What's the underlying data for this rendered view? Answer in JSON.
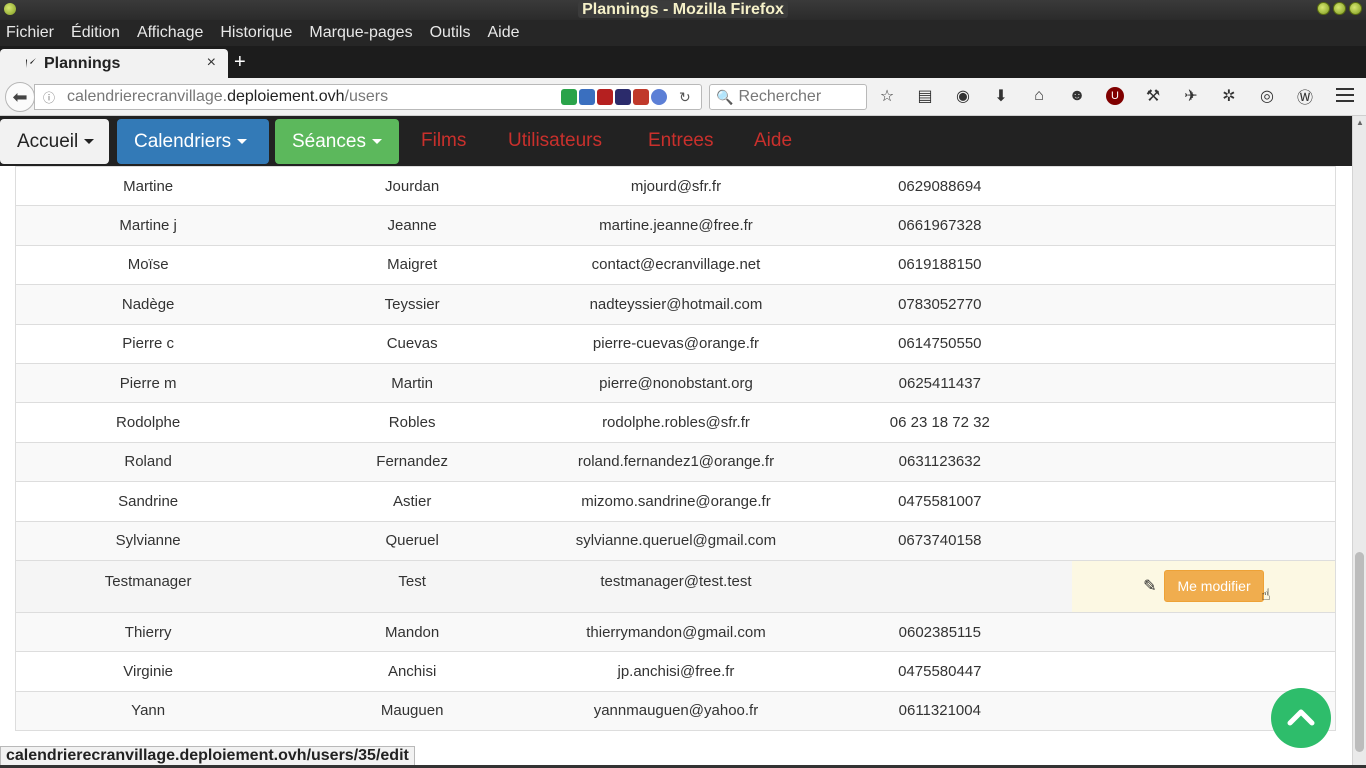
{
  "window": {
    "title": "Plannings - Mozilla Firefox"
  },
  "menubar": [
    "Fichier",
    "Édition",
    "Affichage",
    "Historique",
    "Marque-pages",
    "Outils",
    "Aide"
  ],
  "tab": {
    "title": "Plannings",
    "close": "×",
    "new": "+"
  },
  "nav": {
    "url_prefix": "calendrierecranvillage.",
    "url_domain": "deploiement.ovh",
    "url_path": "/users",
    "search_placeholder": "Rechercher"
  },
  "appnav": {
    "accueil": "Accueil",
    "calendriers": "Calendriers",
    "seances": "Séances",
    "films": "Films",
    "utilisateurs": "Utilisateurs",
    "entrees": "Entrees",
    "aide": "Aide"
  },
  "users": [
    {
      "prenom": "Martine",
      "nom": "Jourdan",
      "email": "mjourd@sfr.fr",
      "tel": "0629088694"
    },
    {
      "prenom": "Martine j",
      "nom": "Jeanne",
      "email": "martine.jeanne@free.fr",
      "tel": "0661967328"
    },
    {
      "prenom": "Moïse",
      "nom": "Maigret",
      "email": "contact@ecranvillage.net",
      "tel": "0619188150"
    },
    {
      "prenom": "Nadège",
      "nom": "Teyssier",
      "email": "nadteyssier@hotmail.com",
      "tel": "0783052770"
    },
    {
      "prenom": "Pierre c",
      "nom": "Cuevas",
      "email": "pierre-cuevas@orange.fr",
      "tel": "0614750550"
    },
    {
      "prenom": "Pierre m",
      "nom": "Martin",
      "email": "pierre@nonobstant.org",
      "tel": "0625411437"
    },
    {
      "prenom": "Rodolphe",
      "nom": "Robles",
      "email": "rodolphe.robles@sfr.fr",
      "tel": "06 23 18 72 32"
    },
    {
      "prenom": "Roland",
      "nom": "Fernandez",
      "email": "roland.fernandez1@orange.fr",
      "tel": "0631123632"
    },
    {
      "prenom": "Sandrine",
      "nom": "Astier",
      "email": "mizomo.sandrine@orange.fr",
      "tel": "0475581007"
    },
    {
      "prenom": "Sylvianne",
      "nom": "Queruel",
      "email": "sylvianne.queruel@gmail.com",
      "tel": "0673740158"
    },
    {
      "prenom": "Testmanager",
      "nom": "Test",
      "email": "testmanager@test.test",
      "tel": ""
    },
    {
      "prenom": "Thierry",
      "nom": "Mandon",
      "email": "thierrymandon@gmail.com",
      "tel": "0602385115"
    },
    {
      "prenom": "Virginie",
      "nom": "Anchisi",
      "email": "jp.anchisi@free.fr",
      "tel": "0475580447"
    },
    {
      "prenom": "Yann",
      "nom": "Mauguen",
      "email": "yannmauguen@yahoo.fr",
      "tel": "0611321004"
    }
  ],
  "edit_button": "Me modifier",
  "status_url_prefix": "calendrierecranvillage.",
  "status_url_rest": "deploiement.ovh/users/35/edit",
  "colors": {
    "primary": "#337ab7",
    "success": "#5cb85c",
    "danger": "#c9302c",
    "warning": "#f0ad4e",
    "scroll_up": "#2ebd6b"
  }
}
